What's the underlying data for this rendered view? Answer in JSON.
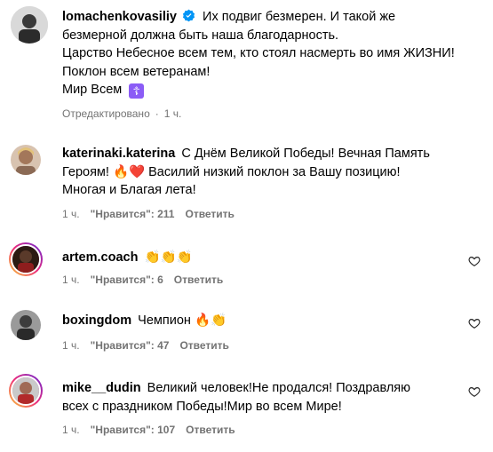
{
  "caption": {
    "username": "lomachenkovasiliy",
    "text_line1": "Их подвиг безмерен. И такой же",
    "text_line2": "безмерной должна быть наша благодарность.",
    "text_line3": "Царство Небесное всем тем, кто стоял насмерть во имя ЖИЗНИ!",
    "text_line4": "Поклон всем ветеранам!",
    "text_line5": "Мир Всем",
    "badge_glyph": "☦",
    "edited": "Отредактировано",
    "time": "1 ч."
  },
  "comments": [
    {
      "username": "katerinaki.katerina",
      "line1": "С Днём Великой Победы! Вечная Память",
      "line2_a": "Героям!",
      "line2_emoji": "🔥❤️",
      "line2_b": "Василий низкий поклон за Вашу позицию!",
      "line3": "Многая и Благая лета!",
      "time": "1 ч.",
      "likes": "\"Нравится\": 211",
      "reply": "Ответить"
    },
    {
      "username": "artem.coach",
      "text_emoji": "👏👏👏",
      "time": "1 ч.",
      "likes": "\"Нравится\": 6",
      "reply": "Ответить"
    },
    {
      "username": "boxingdom",
      "text": "Чемпион",
      "text_emoji": "🔥👏",
      "time": "1 ч.",
      "likes": "\"Нравится\": 47",
      "reply": "Ответить"
    },
    {
      "username": "mike__dudin",
      "line1": "Великий человек!Не продался! Поздравляю",
      "line2": "всех с праздником Победы!Мир во всем Мире!",
      "time": "1 ч.",
      "likes": "\"Нравится\": 107",
      "reply": "Ответить"
    }
  ],
  "colors": {
    "meta": "#737373",
    "verified": "#0095f6"
  },
  "icons": [
    "verified-badge-icon",
    "heart-icon"
  ]
}
